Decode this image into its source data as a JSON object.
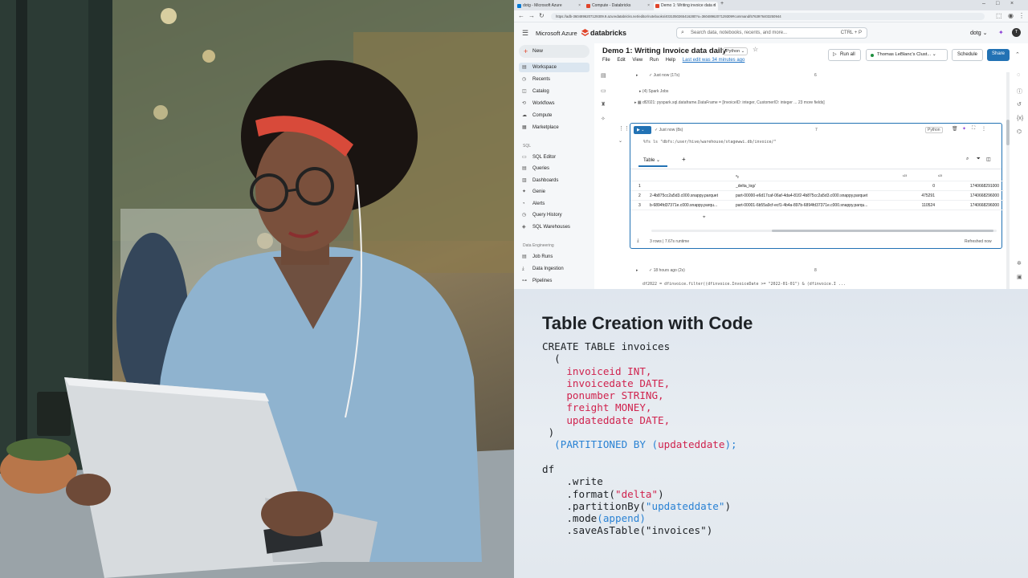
{
  "browser": {
    "tabs": [
      {
        "label": "dotg - Microsoft Azure",
        "favicon_color": "#0078d4"
      },
      {
        "label": "Compute - Databricks",
        "favicon_color": "#e0442a"
      },
      {
        "label": "Demo 1: Writing invoice data d",
        "favicon_color": "#e0442a"
      }
    ],
    "new_tab": "+",
    "url": "https://adb-3604896207129309.9.azuredatabricks.net/editor/notebooks/4031050265416280?o=3604896207129309#command/5763976403250944"
  },
  "header": {
    "brand_azure": "Microsoft Azure",
    "brand_db": "databricks",
    "search_placeholder": "Search data, notebooks, recents, and more...",
    "search_shortcut": "CTRL + P",
    "workspace": "dotg",
    "avatar": "T"
  },
  "sidebar": {
    "new_label": "New",
    "items": [
      {
        "label": "Workspace",
        "icon": "▤",
        "active": true
      },
      {
        "label": "Recents",
        "icon": "◷"
      },
      {
        "label": "Catalog",
        "icon": "◫"
      },
      {
        "label": "Workflows",
        "icon": "⟲"
      },
      {
        "label": "Compute",
        "icon": "☁"
      },
      {
        "label": "Marketplace",
        "icon": "▦"
      }
    ],
    "sql_section": "SQL",
    "sql_items": [
      {
        "label": "SQL Editor",
        "icon": "▭"
      },
      {
        "label": "Queries",
        "icon": "▤"
      },
      {
        "label": "Dashboards",
        "icon": "▥"
      },
      {
        "label": "Genie",
        "icon": "✦"
      },
      {
        "label": "Alerts",
        "icon": "◔"
      },
      {
        "label": "Query History",
        "icon": "◷"
      },
      {
        "label": "SQL Warehouses",
        "icon": "◈"
      }
    ],
    "de_section": "Data Engineering",
    "de_items": [
      {
        "label": "Job Runs",
        "icon": "▤"
      },
      {
        "label": "Data Ingestion",
        "icon": "⤓"
      },
      {
        "label": "Pipelines",
        "icon": "⊶"
      }
    ]
  },
  "notebook": {
    "title": "Demo 1: Writing Invoice data daily",
    "language": "Python",
    "menus": [
      "File",
      "Edit",
      "View",
      "Run",
      "Help"
    ],
    "last_edit": "Last edit was 34 minutes ago",
    "run_all": "Run all",
    "cluster": "Thomas LeBlanc's Clust...",
    "schedule": "Schedule",
    "share": "Share",
    "cell6": {
      "status": "Just now (17s)",
      "number": "6",
      "spark_jobs": "(4) Spark Jobs",
      "df_line": "df2021:  pyspark.sql.dataframe.DataFrame = [InvoiceID: integer, CustomerID: integer ... 23 more fields]"
    },
    "cell7": {
      "status": "Just now (8s)",
      "number": "7",
      "lang": "Python",
      "code": "%fs ls \"dbfs:/user/hive/warehouse/stagewwi.db/invoice/\"",
      "tab": "Table",
      "columns": [
        "path",
        "name",
        "size",
        "modificationTime"
      ],
      "rows": [
        {
          "n": "1",
          "path": "",
          "name": "_delta_log/",
          "size": "0",
          "mod": "1740668291000"
        },
        {
          "n": "2",
          "path": "2-4b875cc2a5d3.c000.snappy.parquet",
          "name": "part-00000-e6d17caf-06af-4da4-81f2-4b875cc2a5d3.c000.snappy.parquet",
          "size": "475291",
          "mod": "1740668296000"
        },
        {
          "n": "3",
          "path": "b-6894fd37371e.c000.snappy.parqu...",
          "name": "part-00001-6b55a9cf-ecf1-4b4a-897b-6894fd37371e.c000.snappy.parqu...",
          "size": "110524",
          "mod": "1740668296000"
        }
      ],
      "footer_rows": "3 rows",
      "footer_runtime": "7.67s runtime",
      "refreshed": "Refreshed now"
    },
    "cell8": {
      "status": "18 hours ago (2s)",
      "number": "8",
      "code": "df2022 = dfinvoice.filter((dfinvoice.InvoiceDate >= \"2022-01-01\") & (dfinvoice.I ..."
    }
  },
  "slide": {
    "title": "Table Creation with Code",
    "line1": "CREATE TABLE invoices",
    "open_paren": "  (",
    "cols": [
      "    invoiceid INT,",
      "    invoicedate DATE,",
      "    ponumber STRING,",
      "    freight MONEY,",
      "    updateddate DATE,"
    ],
    "close_paren": " )",
    "partition_pre": "  (PARTITIONED BY (",
    "partition_col": "updateddate",
    "partition_post": ");",
    "df": "df",
    "write": "    .write",
    "format_pre": "    .format(",
    "format_arg": "\"delta\"",
    "format_post": ")",
    "partby_pre": "    .partitionBy(",
    "partby_arg": "\"updateddate\"",
    "partby_post": ")",
    "mode_pre": "    .mode",
    "mode_arg": "(append)",
    "save": "    .saveAsTable(\"invoices\")"
  },
  "colors": {
    "accent": "#2272b4",
    "brand": "#e0442a",
    "code_red": "#d0234e",
    "code_blue": "#2a82d4"
  }
}
